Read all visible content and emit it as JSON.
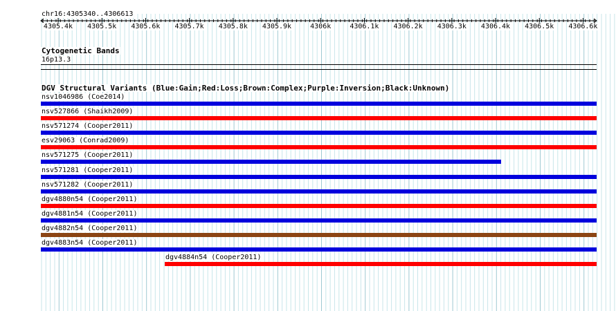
{
  "position": {
    "label": "chr16:4305340..4306613"
  },
  "ruler": {
    "ticks": [
      "4305.4k",
      "4305.5k",
      "4305.6k",
      "4305.7k",
      "4305.8k",
      "4305.9k",
      "4306k",
      "4306.1k",
      "4306.2k",
      "4306.3k",
      "4306.4k",
      "4306.5k",
      "4306.6k"
    ]
  },
  "cytoband_track": {
    "title": "Cytogenetic Bands",
    "band": "16p13.3"
  },
  "dgv_track": {
    "title": "DGV Structural Variants (Blue:Gain;Red:Loss;Brown:Complex;Purple:Inversion;Black:Unknown)",
    "colors": {
      "Gain": "#0000dd",
      "Loss": "#ff0000",
      "Complex": "#8b4513",
      "Inversion": "#800080",
      "Unknown": "#000000"
    },
    "variants": [
      {
        "label": "nsv1046986 (Coe2014)",
        "type": "Gain",
        "span": "full"
      },
      {
        "label": "nsv527866 (Shaikh2009)",
        "type": "Loss",
        "span": "full"
      },
      {
        "label": "nsv571274 (Cooper2011)",
        "type": "Gain",
        "span": "full"
      },
      {
        "label": "esv29063 (Conrad2009)",
        "type": "Loss",
        "span": "full"
      },
      {
        "label": "nsv571275 (Cooper2011)",
        "type": "Gain",
        "span": "partial-right"
      },
      {
        "label": "nsv571281 (Cooper2011)",
        "type": "Gain",
        "span": "full"
      },
      {
        "label": "nsv571282 (Cooper2011)",
        "type": "Gain",
        "span": "full"
      },
      {
        "label": "dgv4880n54 (Cooper2011)",
        "type": "Loss",
        "span": "full"
      },
      {
        "label": "dgv4881n54 (Cooper2011)",
        "type": "Gain",
        "span": "full"
      },
      {
        "label": "dgv4882n54 (Cooper2011)",
        "type": "Complex",
        "span": "full"
      },
      {
        "label": "dgv4883n54 (Cooper2011)",
        "type": "Gain",
        "span": "full"
      },
      {
        "label": "dgv4884n54 (Cooper2011)",
        "type": "Loss",
        "span": "partial-left"
      }
    ]
  }
}
